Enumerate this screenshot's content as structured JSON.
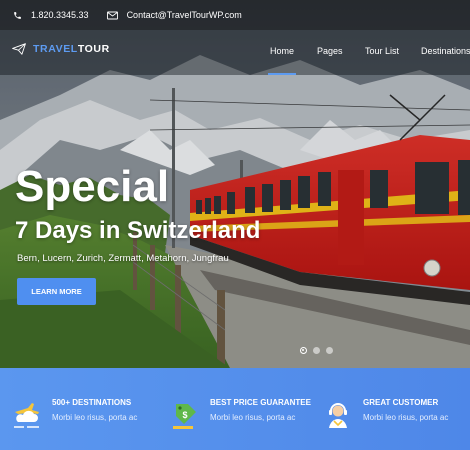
{
  "topbar": {
    "phone": "1.820.3345.33",
    "email": "Contact@TravelTourWP.com"
  },
  "logo": {
    "part1": "TRAVEL",
    "part2": "TOUR"
  },
  "menu": {
    "items": [
      {
        "label": "Home",
        "active": true
      },
      {
        "label": "Pages",
        "active": false
      },
      {
        "label": "Tour List",
        "active": false
      },
      {
        "label": "Destinations",
        "active": false
      }
    ]
  },
  "hero": {
    "title": "Special",
    "subtitle": "7 Days in Switzerland",
    "places": "Bern, Lucern, Zurich, Zermatt, Metahorn, Jungfrau",
    "button": "LEARN MORE",
    "slides": 3,
    "active_slide": 1
  },
  "features": [
    {
      "icon": "plane-cloud-icon",
      "title": "500+ DESTINATIONS",
      "desc": "Morbi leo risus, porta ac"
    },
    {
      "icon": "price-tag-money-icon",
      "title": "BEST PRICE GUARANTEE",
      "desc": "Morbi leo risus, porta ac"
    },
    {
      "icon": "customer-support-icon",
      "title": "GREAT CUSTOMER",
      "desc": "Morbi leo risus, porta ac"
    }
  ],
  "colors": {
    "accent": "#5d9bf1",
    "button": "#4f8ff0",
    "features_bg": "#5b97ef",
    "train": "#d6231c",
    "train_stripe": "#f2c21a"
  }
}
